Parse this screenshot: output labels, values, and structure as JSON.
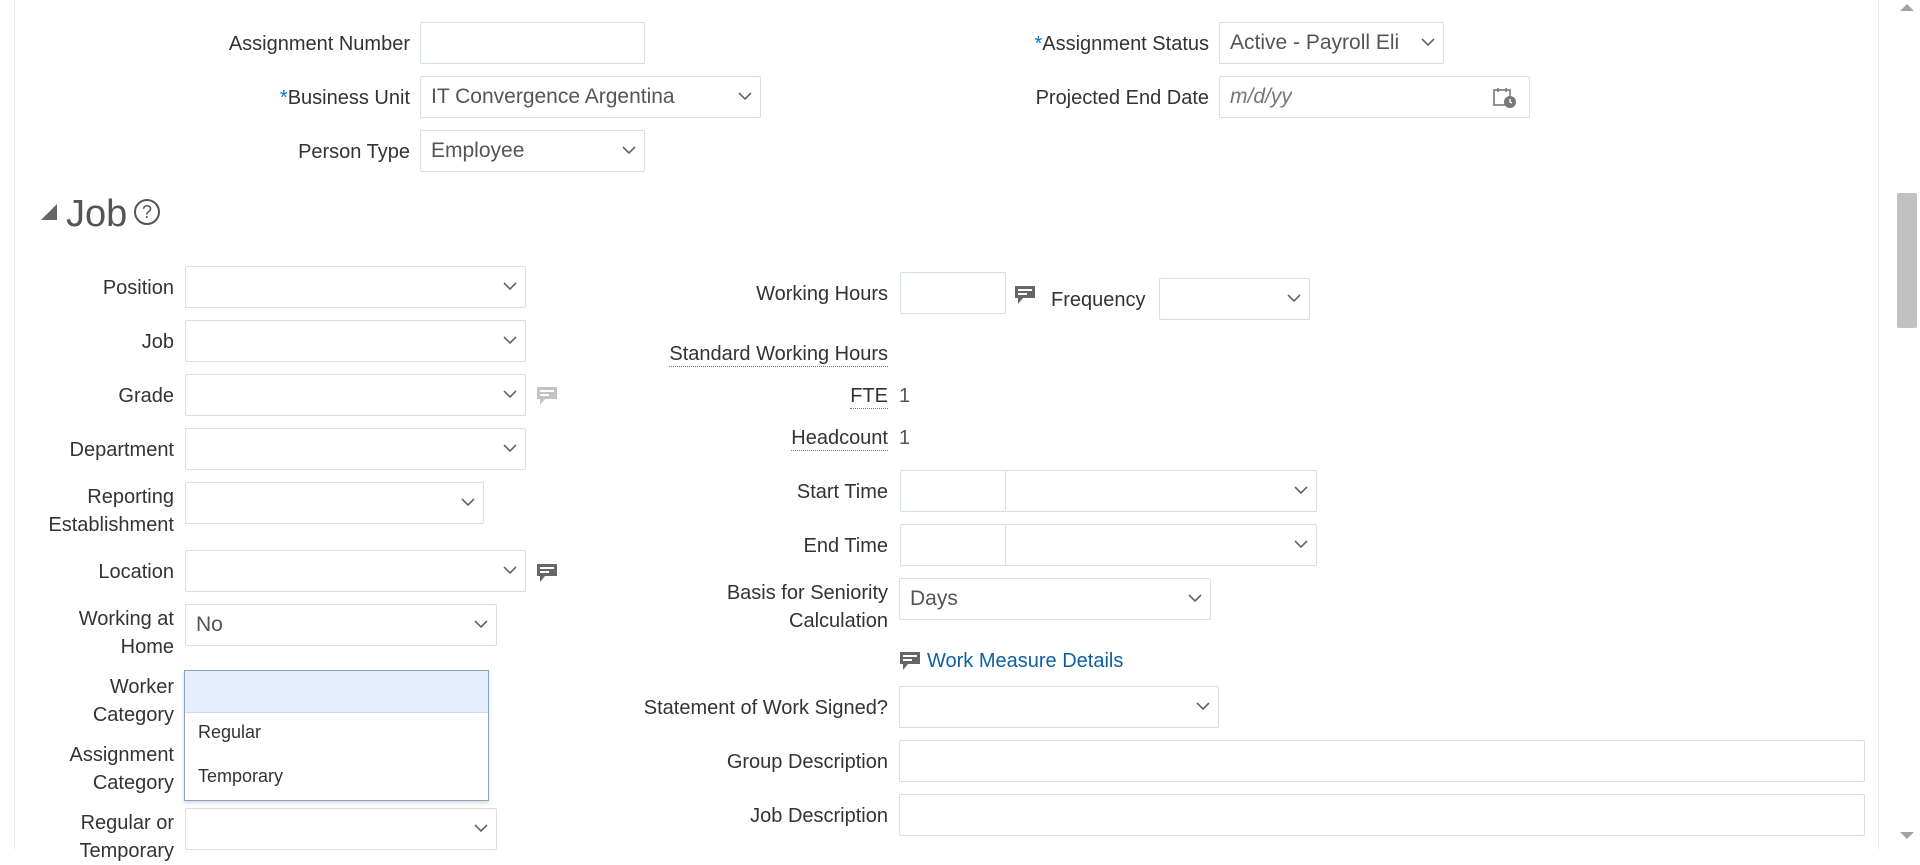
{
  "header_fields": {
    "assignment_number": {
      "label": "Assignment Number",
      "value": ""
    },
    "business_unit": {
      "label": "Business Unit",
      "value": "IT Convergence Argentina",
      "required": true
    },
    "person_type": {
      "label": "Person Type",
      "value": "Employee"
    },
    "assignment_status": {
      "label": "Assignment Status",
      "value": "Active - Payroll Eli",
      "required": true
    },
    "projected_end_date": {
      "label": "Projected End Date",
      "placeholder": "m/d/yy"
    }
  },
  "job_section": {
    "title": "Job",
    "help_glyph": "?",
    "left": {
      "position": {
        "label": "Position",
        "value": ""
      },
      "job": {
        "label": "Job",
        "value": ""
      },
      "grade": {
        "label": "Grade",
        "value": ""
      },
      "department": {
        "label": "Department",
        "value": ""
      },
      "reporting_establishment": {
        "label": "Reporting Establishment",
        "value": ""
      },
      "location": {
        "label": "Location",
        "value": ""
      },
      "working_at_home": {
        "label": "Working at Home",
        "value": "No"
      },
      "worker_category": {
        "label": "Worker Category",
        "value": ""
      },
      "assignment_category": {
        "label": "Assignment Category"
      },
      "regular_or_temporary": {
        "label": "Regular or Temporary",
        "value": ""
      }
    },
    "right": {
      "working_hours": {
        "label": "Working Hours",
        "value": ""
      },
      "frequency": {
        "label": "Frequency",
        "value": ""
      },
      "standard_working_hours": {
        "label": "Standard Working Hours"
      },
      "fte": {
        "label": "FTE",
        "value": "1"
      },
      "headcount": {
        "label": "Headcount",
        "value": "1"
      },
      "start_time": {
        "label": "Start Time",
        "value": "",
        "period": ""
      },
      "end_time": {
        "label": "End Time",
        "value": "",
        "period": ""
      },
      "basis_for_seniority": {
        "label": "Basis for Seniority Calculation",
        "value": "Days"
      },
      "work_measure_details": {
        "label": "Work Measure Details"
      },
      "statement_of_work_signed": {
        "label": "Statement of Work Signed?",
        "value": ""
      },
      "group_description": {
        "label": "Group Description",
        "value": ""
      },
      "job_description": {
        "label": "Job Description",
        "value": ""
      }
    }
  },
  "worker_category_dropdown": {
    "options": [
      "Regular",
      "Temporary"
    ]
  },
  "colors": {
    "required_asterisk": "#0572ce",
    "link": "#0f5fa6",
    "field_border": "#d6dfe6",
    "dropdown_highlight": "#e4effb"
  },
  "icons": {
    "calendar": "calendar-icon",
    "details": "details-icon",
    "chevron": "chevron-down-icon",
    "help": "help-icon",
    "disclosure": "disclosure-triangle-icon"
  }
}
